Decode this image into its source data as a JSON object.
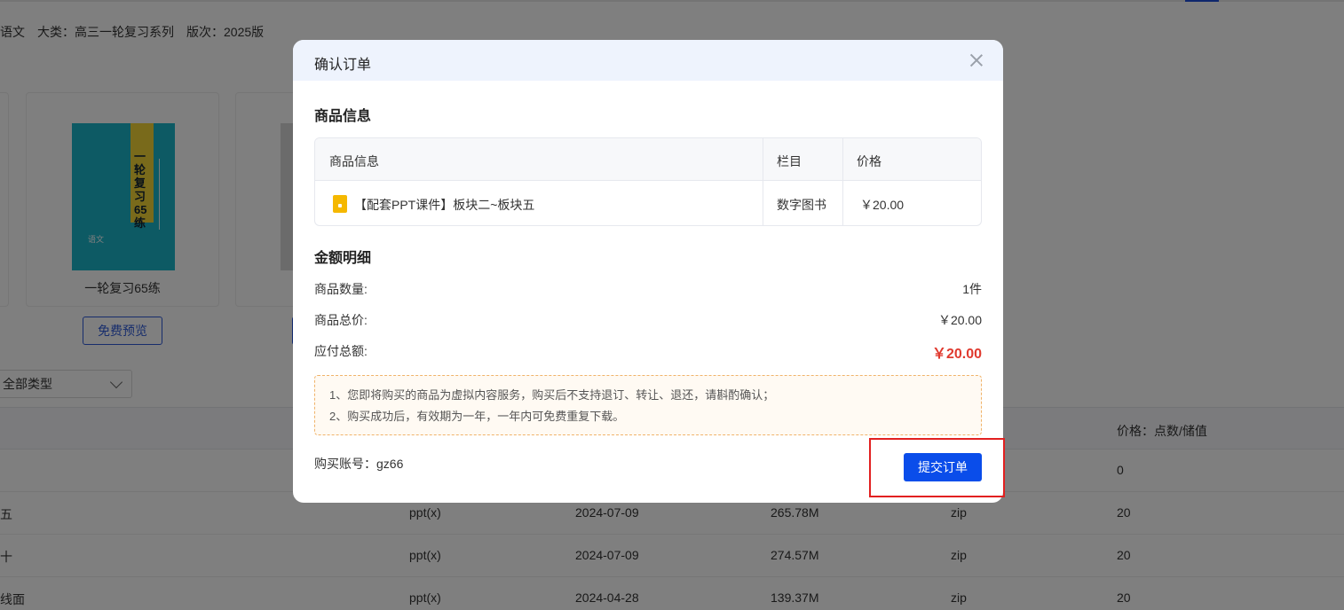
{
  "background": {
    "meta": {
      "subject": "语文",
      "category": "大类：高三一轮复习系列",
      "edition": "版次：2025版"
    },
    "books": [
      {
        "title": "一轮复习65练",
        "cover_title": "一轮复习65练",
        "cover_sub": "语文",
        "preview_label": "免费预览"
      }
    ],
    "filter": {
      "selected": "全部类型"
    },
    "table": {
      "header_price": "价格：点数/储值",
      "rows": [
        {
          "name": "",
          "format": "",
          "date": "",
          "size": "",
          "archive": "",
          "price": "0"
        },
        {
          "name": "五",
          "format": "ppt(x)",
          "date": "2024-07-09",
          "size": "265.78M",
          "archive": "zip",
          "price": "20"
        },
        {
          "name": "十",
          "format": "ppt(x)",
          "date": "2024-07-09",
          "size": "274.57M",
          "archive": "zip",
          "price": "20"
        },
        {
          "name": "线面",
          "format": "ppt(x)",
          "date": "2024-04-28",
          "size": "139.37M",
          "archive": "zip",
          "price": "20"
        }
      ]
    }
  },
  "modal": {
    "title": "确认订单",
    "goods_section_title": "商品信息",
    "goods_table": {
      "headers": [
        "商品信息",
        "栏目",
        "价格"
      ],
      "rows": [
        {
          "name": "【配套PPT课件】板块二~板块五",
          "column": "数字图书",
          "price": "￥20.00",
          "icon": "file-icon"
        }
      ]
    },
    "amount_section_title": "金额明细",
    "amounts": [
      {
        "label": "商品数量:",
        "value": "1件"
      },
      {
        "label": "商品总价:",
        "value": "￥20.00"
      },
      {
        "label": "应付总额:",
        "value": "￥20.00"
      }
    ],
    "notice": [
      "1、您即将购买的商品为虚拟内容服务，购买后不支持退订、转让、退还，请斟酌确认；",
      "2、购买成功后，有效期为一年，一年内可免费重复下载。"
    ],
    "account_label": "购买账号：gz66",
    "submit_label": "提交订单",
    "colors": {
      "accent": "#0a4dea",
      "total": "#e03a2f",
      "highlight": "#e22020"
    }
  }
}
